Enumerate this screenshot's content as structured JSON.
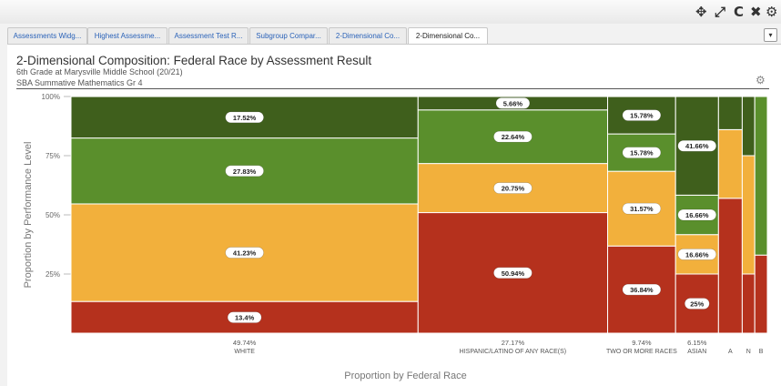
{
  "toolbar": {
    "icons": [
      "move-icon",
      "expand-icon",
      "refresh-icon",
      "close-icon",
      "gear-icon"
    ],
    "move": "✥",
    "expand": "⤢",
    "refresh": "C",
    "close": "✖",
    "gear": "⚙"
  },
  "tabs": [
    {
      "label": "Assessments Widg...",
      "active": false
    },
    {
      "label": "Highest Assessme...",
      "active": false
    },
    {
      "label": "Assessment Test R...",
      "active": false
    },
    {
      "label": "Subgroup Compar...",
      "active": false
    },
    {
      "label": "2-Dimensional Co...",
      "active": false
    },
    {
      "label": "2-Dimensional Co...",
      "active": true
    }
  ],
  "tab_dropdown": "▾",
  "panel": {
    "title": "2-Dimensional Composition: Federal Race by Assessment Result",
    "subtitle": "6th Grade at Marysville Middle School (20/21)",
    "subtitle2": "SBA Summative Mathematics Gr 4",
    "settings_icon": "⚙"
  },
  "colors": {
    "level1": "#b5311d",
    "level2": "#f2b03c",
    "level3": "#5a8f2c",
    "level4": "#3f5f1c"
  },
  "chart_data": {
    "type": "mosaic",
    "ylabel": "Proportion by Performance Level",
    "xlabel": "Proportion by Federal Race",
    "yticks": [
      "25%",
      "50%",
      "75%",
      "100%"
    ],
    "ytick_values": [
      25,
      50,
      75,
      100
    ],
    "levels": [
      "level1",
      "level2",
      "level3",
      "level4"
    ],
    "columns": [
      {
        "name": "WHITE",
        "pct_label": "49.74%",
        "width": 49.74,
        "segments": [
          13.4,
          41.23,
          27.83,
          17.52
        ],
        "labels": [
          "13.4%",
          "41.23%",
          "27.83%",
          "17.52%"
        ]
      },
      {
        "name": "HISPANIC/LATINO OF ANY RACE(S)",
        "pct_label": "27.17%",
        "width": 27.17,
        "segments": [
          50.94,
          20.75,
          22.64,
          5.66
        ],
        "labels": [
          "50.94%",
          "20.75%",
          "22.64%",
          "5.66%"
        ]
      },
      {
        "name": "TWO OR MORE RACES",
        "pct_label": "9.74%",
        "width": 9.74,
        "segments": [
          36.84,
          31.57,
          15.78,
          15.78
        ],
        "labels": [
          "36.84%",
          "31.57%",
          "15.78%",
          "15.78%"
        ]
      },
      {
        "name": "ASIAN",
        "pct_label": "6.15%",
        "width": 6.15,
        "segments": [
          25,
          16.66,
          16.66,
          41.66
        ],
        "labels": [
          "25%",
          "16.66%",
          "16.66%",
          "41.66%"
        ]
      },
      {
        "name": "A",
        "pct_label": "",
        "width": 3.4,
        "segments": [
          57,
          29,
          0,
          14
        ],
        "labels": [
          "",
          "",
          "",
          ""
        ]
      },
      {
        "name": "N",
        "pct_label": "",
        "width": 1.8,
        "segments": [
          25,
          50,
          0,
          25
        ],
        "labels": [
          "",
          "",
          "",
          ""
        ]
      },
      {
        "name": "B",
        "pct_label": "",
        "width": 1.8,
        "segments": [
          33,
          0,
          67,
          0
        ],
        "labels": [
          "",
          "",
          "",
          ""
        ]
      }
    ]
  }
}
